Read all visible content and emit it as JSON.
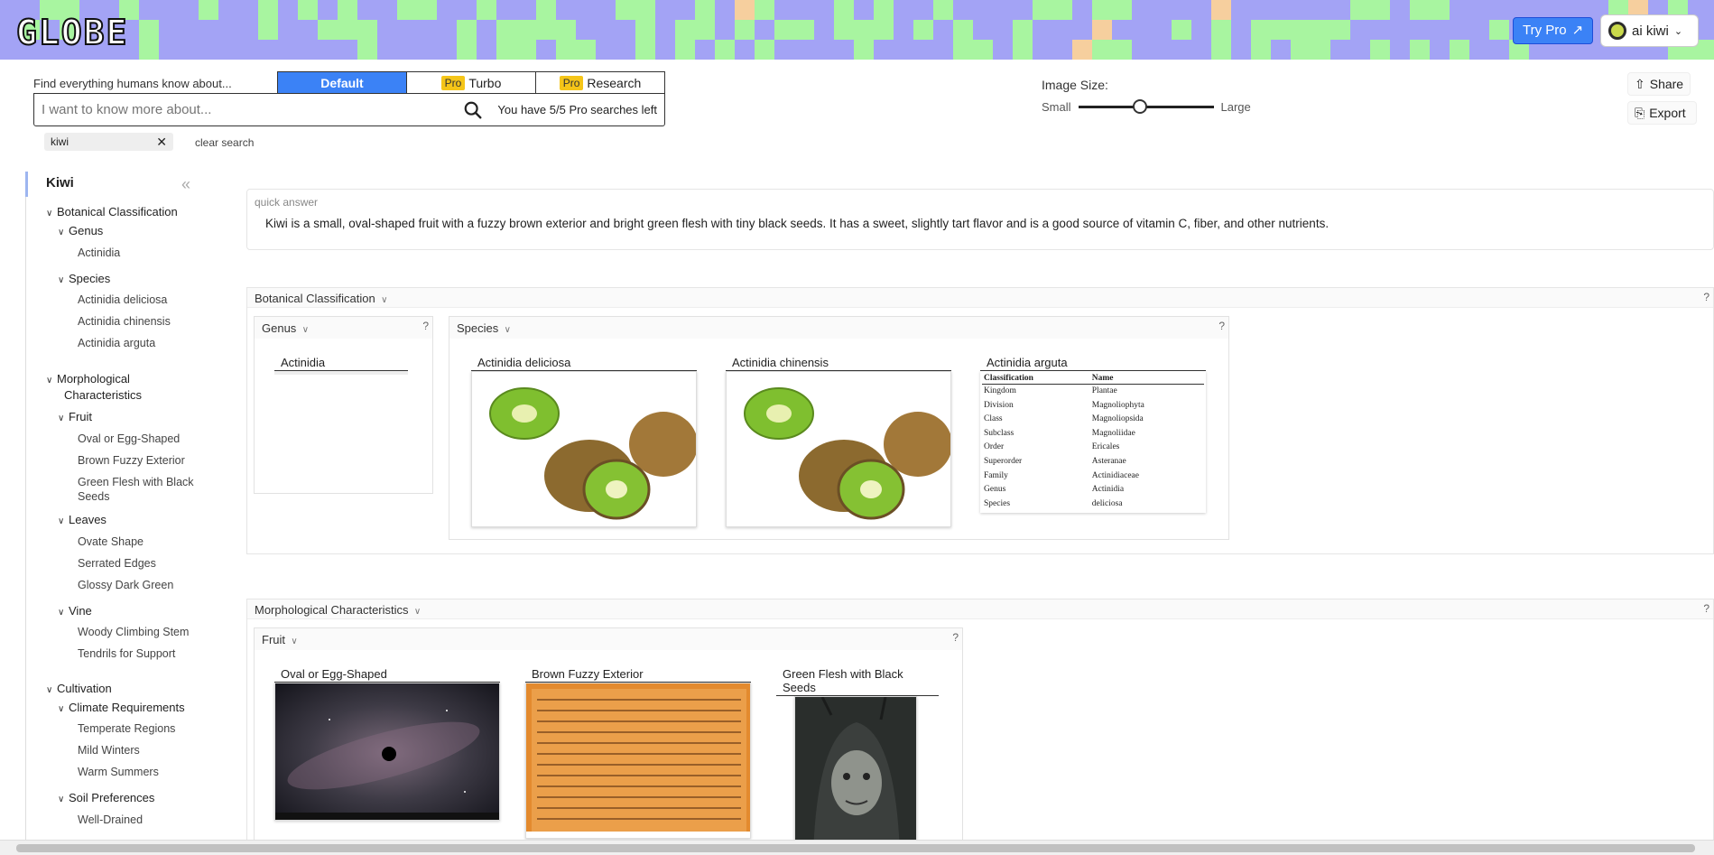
{
  "header": {
    "logo": "GLOBE",
    "try_pro": "Try Pro",
    "user_name": "ai kiwi",
    "pattern_colors": [
      "#a3a3f5",
      "#a8f5a0",
      "#f6cf9e"
    ]
  },
  "search": {
    "find_label": "Find everything humans know about...",
    "modes": [
      {
        "label": "Default",
        "pro": ""
      },
      {
        "label": "Turbo",
        "pro": "Pro"
      },
      {
        "label": "Research",
        "pro": "Pro"
      }
    ],
    "placeholder": "I want to know more about...",
    "pro_left": "You have 5/5 Pro searches left",
    "chip": "kiwi",
    "clear": "clear search"
  },
  "controls": {
    "image_size": "Image Size:",
    "small": "Small",
    "large": "Large",
    "slider_value": 0.45,
    "share": "Share",
    "export": "Export"
  },
  "sidebar": {
    "title": "Kiwi",
    "bot": "Botanical Classification",
    "genus": "Genus",
    "actinidia": "Actinidia",
    "species": "Species",
    "sp1": "Actinidia deliciosa",
    "sp2": "Actinidia chinensis",
    "sp3": "Actinidia arguta",
    "morph1": "Morphological",
    "morph2": "Characteristics",
    "fruit": "Fruit",
    "oval": "Oval or Egg-Shaped",
    "brown": "Brown Fuzzy Exterior",
    "green1": "Green Flesh with Black",
    "green2": "Seeds",
    "leaves": "Leaves",
    "ovate": "Ovate Shape",
    "serrated": "Serrated Edges",
    "glossy": "Glossy Dark Green",
    "vine": "Vine",
    "woody": "Woody Climbing Stem",
    "tendrils": "Tendrils for Support",
    "cultivation": "Cultivation",
    "climate": "Climate Requirements",
    "temperate": "Temperate Regions",
    "mild": "Mild Winters",
    "warm": "Warm Summers",
    "soil": "Soil Preferences",
    "drained": "Well-Drained"
  },
  "quick_answer": {
    "label": "quick answer",
    "text": "Kiwi is a small, oval-shaped fruit with a fuzzy brown exterior and bright green flesh with tiny black seeds. It has a sweet, slightly tart flavor and is a good source of vitamin C, fiber, and other nutrients."
  },
  "botanical": {
    "title": "Botanical Classification",
    "genus_title": "Genus",
    "genus_card": "Actinidia",
    "species_title": "Species",
    "card1": "Actinidia deliciosa",
    "card2": "Actinidia chinensis",
    "card3": "Actinidia arguta",
    "table_headers": [
      "Classification",
      "Name"
    ],
    "table_rows": [
      [
        "Kingdom",
        "Plantae"
      ],
      [
        "Division",
        "Magnoliophyta"
      ],
      [
        "Class",
        "Magnoliopsida"
      ],
      [
        "Subclass",
        "Magnoliidae"
      ],
      [
        "Order",
        "Ericales"
      ],
      [
        "Superorder",
        "Asteranae"
      ],
      [
        "Family",
        "Actinidiaceae"
      ],
      [
        "Genus",
        "Actinidia"
      ],
      [
        "Species",
        "deliciosa"
      ]
    ]
  },
  "morphological": {
    "title": "Morphological Characteristics",
    "fruit_title": "Fruit",
    "card1": "Oval or Egg-Shaped",
    "card2": "Brown Fuzzy Exterior",
    "card3": "Green Flesh with Black Seeds"
  },
  "help_mark": "?"
}
